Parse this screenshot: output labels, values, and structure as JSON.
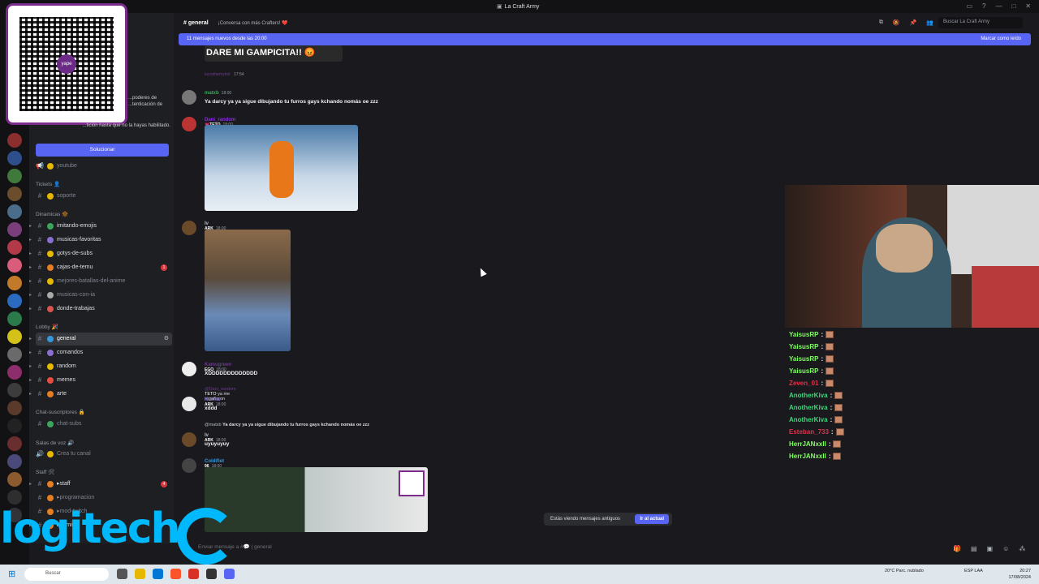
{
  "window": {
    "title": "La Craft Army"
  },
  "header": {
    "channel": "general",
    "topic": "¡Conversa con más Crafters! ❤️",
    "search_placeholder": "Buscar La Craft Army"
  },
  "new_messages_bar": {
    "text": "11 mensajes nuevos desde las 20:00",
    "action": "Marcar como leído"
  },
  "sidebar": {
    "warning_text": "...poderes de ...tenticación de",
    "warning_text2": "...tición hasta que no la hayas habilitado.",
    "solve_button": "Solucionar",
    "top_channel": "youtube",
    "categories": {
      "tickets": "Tickets 👤",
      "dinamicas": "Dinamicas 🔆",
      "lobby": "Lobby 🎉",
      "chat_suscriptores": "Chat-suscriptores 🔒",
      "salas_voz": "Salas de voz 🔊",
      "staff": "Staff 🛠"
    },
    "channels": {
      "soporte": "soporte",
      "imitando_emojis": "imitando-emojis",
      "musicas_favoritas": "musicas-favoritas",
      "gotys_de_subs": "gotys-de-subs",
      "cajas_de_temu": "cajas-de-temu",
      "mejores_batallas": "mejores-batallas-del-anime",
      "musicas_con_ia": "musicas-con-ia",
      "donde_trabajas": "donde-trabajas",
      "general": "general",
      "comandos": "comandos",
      "random": "random",
      "memes": "memes",
      "arte": "arte",
      "chat_subs": "chat-subs",
      "crea_tu_canal": "Crea tu canal",
      "staff": "▸staff",
      "programacion": "▸programacion",
      "mod_twitch": "▸mod-twitch",
      "admin": "▸admin"
    },
    "unread_counts": {
      "cajas_de_temu": "1",
      "staff": "4"
    }
  },
  "messages": {
    "banner_text": "DARE MI GAMPICITA!! 😡",
    "faded_name": "lacraftarmybot",
    "faded_ts": "17:54",
    "m1": {
      "user": "matxb",
      "time": "18:00",
      "text": "Ya darcy ya ya sigue dibujando tu furros gays kchando nomás oe zzz"
    },
    "m2": {
      "user": "Dani_random",
      "badge": "💗TETO",
      "time": "18:00"
    },
    "m3": {
      "user": "Iv",
      "badge": "ARK",
      "time": "18:00"
    },
    "m4": {
      "user": "Kamugreen",
      "badge": "EGO",
      "time": "18:00",
      "text": "XDDDDDDDDDDDDD"
    },
    "m5": {
      "reply_user": "@Dani_random",
      "reply_badge": "TETO",
      "reply_text": "ya me regañaron",
      "user": "Kroma",
      "badge": "ARK",
      "time": "18:00",
      "text": "xddd"
    },
    "m6": {
      "reply_user": "@matxb",
      "reply_text": "Ya darcy ya ya sigue dibujando tu furros gays kchando nomás oe zzz",
      "user": "Iv",
      "badge": "ARK",
      "time": "18:00",
      "text": "uyuyuyuy"
    },
    "m7": {
      "user": "Coldifiet",
      "badge": "96",
      "time": "18:00"
    }
  },
  "old_messages": {
    "text": "Estás viendo mensajes antiguos",
    "button": "Ir al actual"
  },
  "input": {
    "placeholder": "Enviar mensaje a #💬 | general"
  },
  "stream_chat": [
    {
      "name": "YaisusRP",
      "color": "#7fff5f"
    },
    {
      "name": "YaisusRP",
      "color": "#7fff5f"
    },
    {
      "name": "YaisusRP",
      "color": "#7fff5f"
    },
    {
      "name": "YaisusRP",
      "color": "#7fff5f"
    },
    {
      "name": "Zeven_01",
      "color": "#e0304a"
    },
    {
      "name": "AnotherKiva",
      "color": "#3fd67a"
    },
    {
      "name": "AnotherKiva",
      "color": "#3fd67a"
    },
    {
      "name": "AnotherKiva",
      "color": "#3fd67a"
    },
    {
      "name": "Esteban_733",
      "color": "#e0304a"
    },
    {
      "name": "HerrJANxxII",
      "color": "#7fff5f"
    },
    {
      "name": "HerrJANxxII",
      "color": "#7fff5f"
    }
  ],
  "overlay": {
    "brand": "logitech"
  },
  "taskbar": {
    "search": "Buscar",
    "lang": "ESP LAA",
    "time": "20:27",
    "date": "17/08/2024",
    "weather": "20°C Parc. nublado"
  },
  "colors": {
    "accent": "#5865f2",
    "unread": "#da373c",
    "brand": "#00b8fc"
  }
}
